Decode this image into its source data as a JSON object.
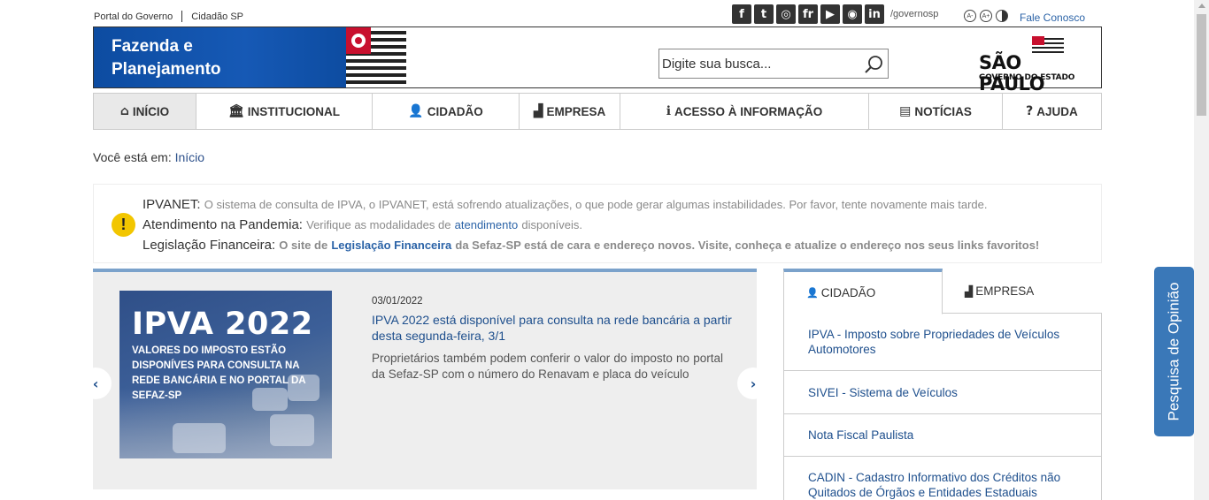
{
  "top": {
    "portal_link": "Portal do Governo",
    "cidadao_link": "Cidadão SP",
    "social": [
      "f",
      "t",
      "◎",
      "fr",
      "▶",
      "◉",
      "in"
    ],
    "social_icons": [
      "facebook-icon",
      "twitter-icon",
      "instagram-icon",
      "flickr-icon",
      "youtube-icon",
      "periscope-icon",
      "linkedin-icon"
    ],
    "handle": "/governosp",
    "fale_conosco": "Fale Conosco"
  },
  "header": {
    "brand_title": "Fazenda e Planejamento",
    "search_placeholder": "Digite sua busca...",
    "logo_big": "SÃO PAULO",
    "logo_small": "GOVERNO DO ESTADO"
  },
  "nav": {
    "items": [
      {
        "label": "INÍCIO",
        "icon": "⌂"
      },
      {
        "label": "INSTITUCIONAL",
        "icon": "🏛"
      },
      {
        "label": "CIDADÃO",
        "icon": "👤"
      },
      {
        "label": "EMPRESA",
        "icon": "▟"
      },
      {
        "label": "ACESSO À INFORMAÇÃO",
        "icon": "ℹ"
      },
      {
        "label": "NOTÍCIAS",
        "icon": "▤"
      },
      {
        "label": "AJUDA",
        "icon": "?"
      }
    ]
  },
  "breadcrumb": {
    "prefix": "Você está em:",
    "link": "Início"
  },
  "notices": {
    "n1_label": "IPVANET:",
    "n1_text": "O sistema de consulta de IPVA, o IPVANET, está sofrendo atualizações, o que pode gerar algumas instabilidades. Por favor, tente novamente mais tarde.",
    "n2_label": "Atendimento na Pandemia:",
    "n2_text_a": "Verifique as modalidades de",
    "n2_link": "atendimento",
    "n2_text_b": "disponíveis.",
    "n3_label": "Legislação Financeira:",
    "n3_text_a": "O site de",
    "n3_link": "Legislação Financeira",
    "n3_text_b": "da Sefaz-SP está de cara e endereço novos. Visite, conheça e atualize o endereço nos seus links favoritos!"
  },
  "carousel": {
    "image_title": "IPVA 2022",
    "image_text": "VALORES DO IMPOSTO ESTÃO DISPONÍVES PARA CONSULTA NA REDE BANCÁRIA E NO PORTAL DA SEFAZ-SP",
    "date": "03/01/2022",
    "title": "IPVA 2022 está disponível para consulta na rede bancária a partir desta segunda-feira, 3/1",
    "text": "Proprietários também podem conferir o valor do imposto no portal da Sefaz-SP com o número do Renavam e placa do veículo",
    "prev": "‹",
    "next": "›"
  },
  "services": {
    "tab_cidadao": "CIDADÃO",
    "tab_empresa": "EMPRESA",
    "items": [
      "IPVA - Imposto sobre Propriedades de Veículos Automotores",
      "SIVEI - Sistema de Veículos",
      "Nota Fiscal Paulista",
      "CADIN - Cadastro Informativo dos Créditos não Quitados de Órgãos e Entidades Estaduais"
    ]
  },
  "feedback": "Pesquisa de Opinião",
  "colors": {
    "brand_blue": "#0d4ca1",
    "link_blue": "#1e4f8d",
    "accent": "#7ba2cb",
    "warn": "#f2c600"
  }
}
